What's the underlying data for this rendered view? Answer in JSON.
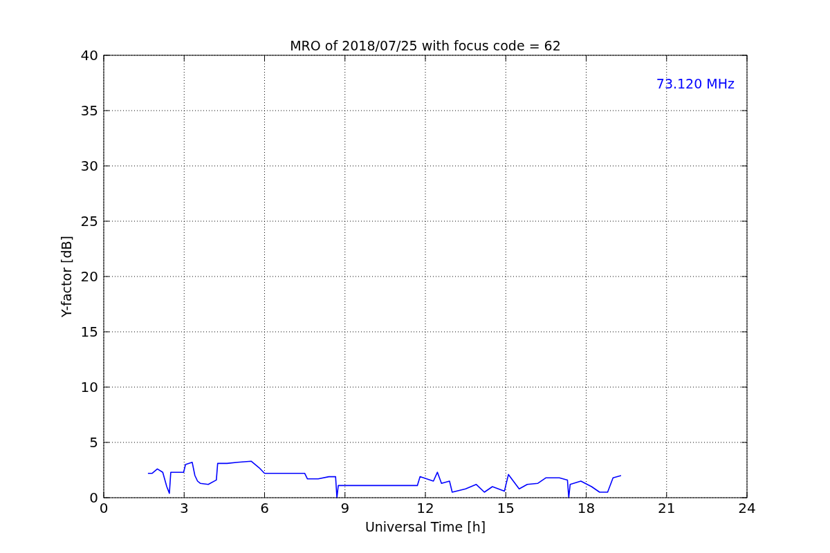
{
  "figure": {
    "chart_data": {
      "type": "line",
      "title": "MRO of 2018/07/25 with focus code = 62",
      "xlabel": "Universal Time [h]",
      "ylabel": "Y-factor [dB]",
      "xlim": [
        0,
        24
      ],
      "ylim": [
        0,
        40
      ],
      "xticks": [
        0,
        3,
        6,
        9,
        12,
        15,
        18,
        21,
        24
      ],
      "yticks": [
        0,
        5,
        10,
        15,
        20,
        25,
        30,
        35,
        40
      ],
      "x": [
        1.65,
        1.8,
        2.0,
        2.2,
        2.35,
        2.45,
        2.5,
        2.8,
        2.98,
        3.05,
        3.3,
        3.4,
        3.5,
        3.6,
        3.9,
        4.2,
        4.25,
        4.6,
        5.0,
        5.5,
        5.8,
        6.0,
        7.5,
        7.6,
        8.0,
        8.4,
        8.65,
        8.7,
        8.75,
        11.7,
        11.8,
        12.3,
        12.45,
        12.6,
        12.9,
        13.0,
        13.5,
        13.9,
        14.2,
        14.5,
        14.95,
        15.1,
        15.5,
        15.8,
        16.2,
        16.5,
        17.0,
        17.3,
        17.35,
        17.4,
        17.8,
        18.2,
        18.5,
        18.8,
        19.0,
        19.3
      ],
      "series": [
        {
          "color": "#0000ff",
          "values": [
            2.2,
            2.2,
            2.6,
            2.3,
            1.0,
            0.4,
            2.3,
            2.3,
            2.3,
            3.0,
            3.2,
            2.0,
            1.5,
            1.3,
            1.2,
            1.6,
            3.1,
            3.1,
            3.2,
            3.3,
            2.7,
            2.2,
            2.2,
            1.7,
            1.7,
            1.9,
            1.9,
            0.0,
            1.1,
            1.1,
            1.9,
            1.5,
            2.3,
            1.3,
            1.5,
            0.5,
            0.8,
            1.2,
            0.5,
            1.0,
            0.6,
            2.1,
            0.8,
            1.2,
            1.3,
            1.8,
            1.8,
            1.6,
            0.0,
            1.2,
            1.5,
            1.0,
            0.5,
            0.5,
            1.8,
            2.0
          ]
        }
      ],
      "grid": true,
      "annotations": [
        "73.120 MHz"
      ]
    }
  }
}
